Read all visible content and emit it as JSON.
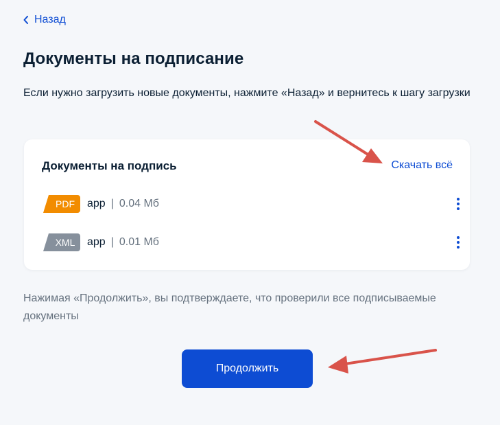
{
  "back_label": "Назад",
  "title": "Документы на подписание",
  "intro_text": "Если нужно загрузить новые документы, нажмите «Назад» и вернитесь к шагу загрузки",
  "card": {
    "title": "Документы на подпись",
    "download_all_label": "Скачать всё",
    "files": [
      {
        "type": "PDF",
        "name": "app",
        "separator": "|",
        "size": "0.04 Мб",
        "badge_color": "#f28c00"
      },
      {
        "type": "XML",
        "name": "app",
        "separator": "|",
        "size": "0.01 Мб",
        "badge_color": "#86909c"
      }
    ]
  },
  "confirm_text": "Нажимая «Продолжить», вы подтверждаете, что проверили все подписываемые документы",
  "continue_label": "Продолжить",
  "colors": {
    "accent": "#0d4cd3",
    "annotation_arrow": "#d9534a"
  }
}
